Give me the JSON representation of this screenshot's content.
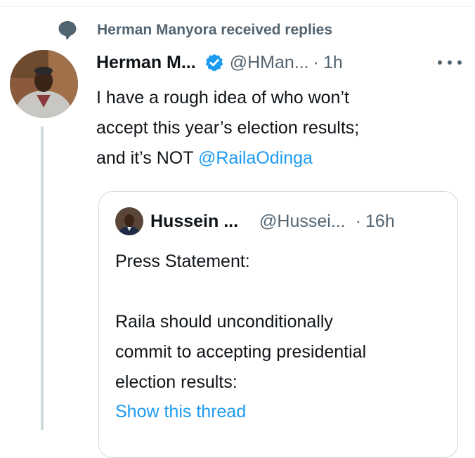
{
  "social_context": {
    "text": "Herman Manyora received replies",
    "icon": "speech-bubble-icon"
  },
  "tweet": {
    "author_name": "Herman M...",
    "verified_icon": "verified-badge-icon",
    "handle": "@HMan...",
    "separator": "·",
    "time": "1h",
    "text_lines": [
      "I have a rough idea of who won’t",
      "accept this year’s election results;"
    ],
    "last_line_prefix": "and it’s NOT ",
    "mention": "@RailaOdinga",
    "more_icon": "more-options-icon"
  },
  "quote": {
    "author_name": "Hussein ...",
    "handle": "@Hussei...",
    "separator": "·",
    "time": "16h",
    "title": "Press Statement:",
    "body_lines": [
      "Raila should unconditionally",
      "commit to accepting presidential",
      "election results:"
    ],
    "show_thread": "Show this thread"
  },
  "colors": {
    "accent": "#1d9bf0",
    "secondary_text": "#536471",
    "border": "#cfd9de",
    "text": "#0f1419"
  }
}
